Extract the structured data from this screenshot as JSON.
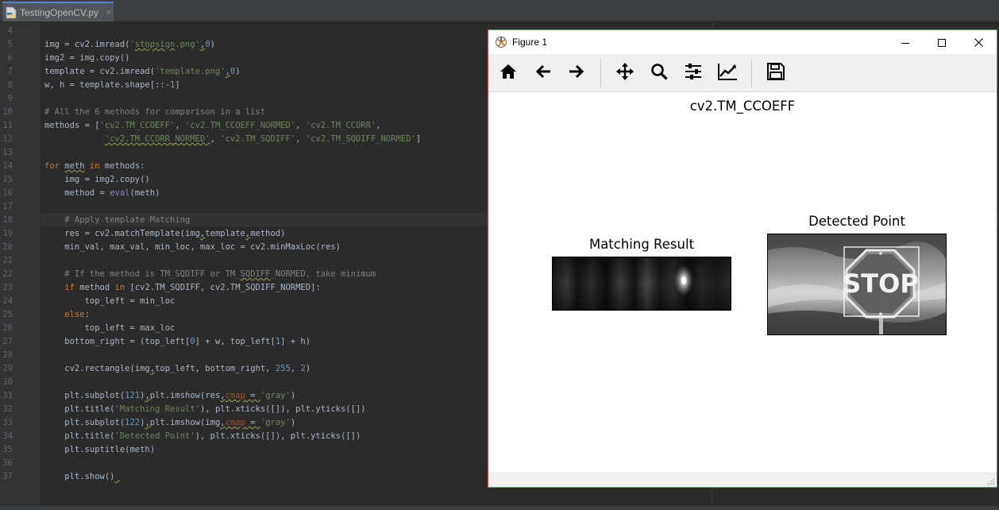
{
  "ide": {
    "tab_label": "TestingOpenCV.py",
    "tab_close": "×",
    "line_numbers": [
      "4",
      "5",
      "6",
      "7",
      "8",
      "9",
      "10",
      "11",
      "12",
      "13",
      "14",
      "15",
      "16",
      "17",
      "18",
      "19",
      "20",
      "21",
      "22",
      "23",
      "24",
      "25",
      "26",
      "27",
      "28",
      "29",
      "30",
      "31",
      "32",
      "33",
      "34",
      "35",
      "36",
      "37"
    ]
  },
  "figure": {
    "window_title": "Figure 1",
    "suptitle": "cv2.TM_CCOEFF",
    "left_title": "Matching Result",
    "right_title": "Detected Point",
    "stop_text": "STOP"
  },
  "colors": {
    "editor_bg": "#2b2b2b",
    "keyword": "#cc7832",
    "string": "#6a8759",
    "comment": "#808080",
    "number": "#6897bb",
    "builtin": "#8888c6",
    "accent_border": "#d9534f"
  },
  "icons": [
    "python-file-icon",
    "matplotlib-icon",
    "minimize-icon",
    "maximize-icon",
    "close-icon",
    "home-icon",
    "back-arrow-icon",
    "forward-arrow-icon",
    "pan-icon",
    "zoom-icon",
    "subplots-config-icon",
    "edit-axis-icon",
    "save-icon"
  ]
}
